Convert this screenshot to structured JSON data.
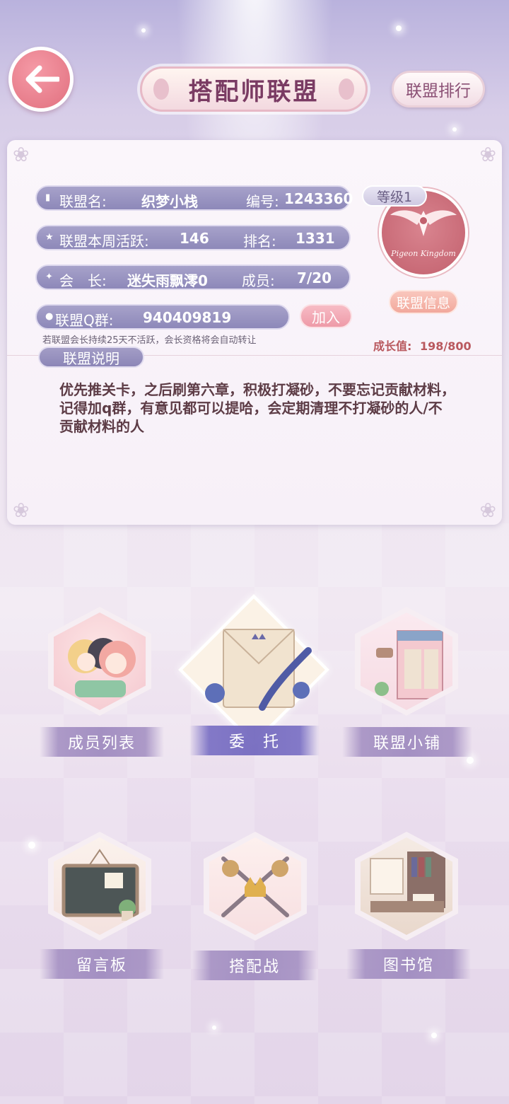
{
  "header": {
    "title": "搭配师联盟",
    "rank_button": "联盟排行"
  },
  "alliance": {
    "name_label": "联盟名:",
    "name": "织梦小栈",
    "id_label": "编号:",
    "id": "1243360",
    "weekly_label": "联盟本周活跃:",
    "weekly": "146",
    "rank_label": "排名:",
    "rank": "1331",
    "leader_label": "会　长:",
    "leader": "迷失雨飘澪0",
    "members_label": "成员:",
    "members": "7/20",
    "qq_label": "联盟Q群:",
    "qq": "940409819",
    "join_button": "加入",
    "note": "若联盟会长持续25天不活跃，会长资格将会自动转让",
    "level": "等级1",
    "emblem_text": "Pigeon Kingdom",
    "info_button": "联盟信息",
    "growth_label": "成长值:",
    "growth": "198/800",
    "desc_label": "联盟说明",
    "description": "优先推关卡，之后刷第六章，积极打凝砂，不要忘记贡献材料，记得加q群，有意见都可以提哈，会定期清理不打凝砂的人/不贡献材料的人"
  },
  "menu": [
    {
      "label": "成员列表",
      "icon": "members-icon"
    },
    {
      "label": "委　托",
      "icon": "letter-quill-icon"
    },
    {
      "label": "联盟小铺",
      "icon": "shop-icon"
    },
    {
      "label": "留言板",
      "icon": "chalkboard-icon"
    },
    {
      "label": "搭配战",
      "icon": "crossed-swords-icon"
    },
    {
      "label": "图书馆",
      "icon": "library-icon"
    }
  ],
  "colors": {
    "accent_pink": "#e1707f",
    "bar_purple": "#8d88b9",
    "growth_text": "#b9585e"
  }
}
